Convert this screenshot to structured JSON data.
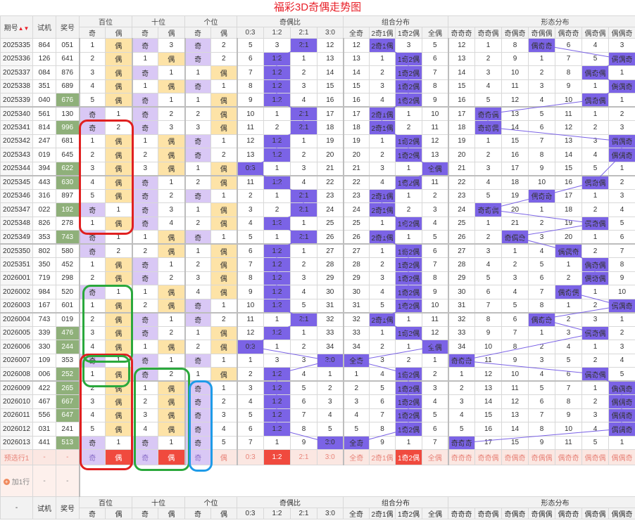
{
  "title": "福彩3D奇偶走势图",
  "header": {
    "issue": "期号",
    "sort_arrow": "▲▼",
    "test": "试机",
    "prize": "奖号",
    "hundreds": "百位",
    "tens": "十位",
    "units": "个位",
    "ratio": "奇偶比",
    "combo": "组合分布",
    "pattern": "形态分布",
    "ji": "奇",
    "ou": "偶",
    "ratio_cols": [
      "0:3",
      "1:2",
      "2:1",
      "3:0"
    ],
    "combo_cols": [
      "全奇",
      "2奇1偶",
      "1奇2偶",
      "全偶"
    ],
    "pattern_cols": [
      "奇奇奇",
      "奇奇偶",
      "奇偶奇",
      "奇偶偶",
      "偶奇奇",
      "偶奇偶",
      "偶偶奇",
      "偶偶偶"
    ]
  },
  "rows": [
    {
      "issue": "2025335",
      "test": "864",
      "prize": "051",
      "c": [
        "1",
        "偶",
        "奇",
        "3",
        "奇",
        "2",
        "5",
        "3",
        "2:1",
        "12",
        "12",
        "2奇1偶",
        "3",
        "5",
        "12",
        "1",
        "8",
        "偶奇奇",
        "6",
        "4",
        "3"
      ]
    },
    {
      "issue": "2025336",
      "test": "126",
      "prize": "641",
      "c": [
        "2",
        "偶",
        "1",
        "偶",
        "奇",
        "2",
        "6",
        "1:2",
        "1",
        "13",
        "13",
        "1",
        "1奇2偶",
        "6",
        "13",
        "2",
        "9",
        "1",
        "7",
        "5",
        "偶偶奇"
      ]
    },
    {
      "issue": "2025337",
      "test": "084",
      "prize": "876",
      "c": [
        "3",
        "偶",
        "奇",
        "1",
        "1",
        "偶",
        "7",
        "1:2",
        "2",
        "14",
        "14",
        "2",
        "1奇2偶",
        "7",
        "14",
        "3",
        "10",
        "2",
        "8",
        "偶奇偶",
        "1"
      ]
    },
    {
      "issue": "2025338",
      "test": "351",
      "prize": "689",
      "c": [
        "4",
        "偶",
        "1",
        "偶",
        "奇",
        "1",
        "8",
        "1:2",
        "3",
        "15",
        "15",
        "3",
        "1奇2偶",
        "8",
        "15",
        "4",
        "11",
        "3",
        "9",
        "1",
        "偶偶奇"
      ]
    },
    {
      "issue": "2025339",
      "test": "040",
      "prize": "676",
      "c": [
        "5",
        "偶",
        "奇",
        "1",
        "1",
        "偶",
        "9",
        "1:2",
        "4",
        "16",
        "16",
        "4",
        "1奇2偶",
        "9",
        "16",
        "5",
        "12",
        "4",
        "10",
        "偶奇偶",
        "1"
      ]
    },
    {
      "issue": "2025340",
      "test": "561",
      "prize": "130",
      "c": [
        "奇",
        "1",
        "奇",
        "2",
        "2",
        "偶",
        "10",
        "1",
        "2:1",
        "17",
        "17",
        "2奇1偶",
        "1",
        "10",
        "17",
        "奇奇偶",
        "13",
        "5",
        "11",
        "1",
        "2"
      ]
    },
    {
      "issue": "2025341",
      "test": "814",
      "prize": "996",
      "c": [
        "奇",
        "2",
        "奇",
        "3",
        "3",
        "偶",
        "11",
        "2",
        "2:1",
        "18",
        "18",
        "2奇1偶",
        "2",
        "11",
        "18",
        "奇奇偶",
        "14",
        "6",
        "12",
        "2",
        "3"
      ]
    },
    {
      "issue": "2025342",
      "test": "247",
      "prize": "681",
      "c": [
        "1",
        "偶",
        "1",
        "偶",
        "奇",
        "1",
        "12",
        "1:2",
        "1",
        "19",
        "19",
        "1",
        "1奇2偶",
        "12",
        "19",
        "1",
        "15",
        "7",
        "13",
        "3",
        "偶偶奇"
      ]
    },
    {
      "issue": "2025343",
      "test": "019",
      "prize": "645",
      "c": [
        "2",
        "偶",
        "2",
        "偶",
        "奇",
        "2",
        "13",
        "1:2",
        "2",
        "20",
        "20",
        "2",
        "1奇2偶",
        "13",
        "20",
        "2",
        "16",
        "8",
        "14",
        "4",
        "偶偶奇"
      ]
    },
    {
      "issue": "2025344",
      "test": "394",
      "prize": "622",
      "c": [
        "3",
        "偶",
        "3",
        "偶",
        "1",
        "偶",
        "0:3",
        "1",
        "3",
        "21",
        "21",
        "3",
        "1",
        "全偶",
        "21",
        "3",
        "17",
        "9",
        "15",
        "5",
        "1"
      ]
    },
    {
      "issue": "2025345",
      "test": "443",
      "prize": "630",
      "c": [
        "4",
        "偶",
        "奇",
        "1",
        "2",
        "偶",
        "11",
        "1:2",
        "4",
        "22",
        "22",
        "4",
        "1奇2偶",
        "11",
        "22",
        "4",
        "18",
        "10",
        "16",
        "偶奇偶",
        "2"
      ]
    },
    {
      "issue": "2025346",
      "test": "316",
      "prize": "897",
      "c": [
        "5",
        "偶",
        "奇",
        "2",
        "奇",
        "1",
        "2",
        "1",
        "2:1",
        "23",
        "23",
        "2奇1偶",
        "1",
        "2",
        "23",
        "5",
        "19",
        "偶奇奇",
        "17",
        "1",
        "3"
      ]
    },
    {
      "issue": "2025347",
      "test": "022",
      "prize": "192",
      "c": [
        "奇",
        "1",
        "奇",
        "3",
        "1",
        "偶",
        "3",
        "2",
        "2:1",
        "24",
        "24",
        "2奇1偶",
        "2",
        "3",
        "24",
        "奇奇偶",
        "20",
        "1",
        "18",
        "2",
        "4"
      ]
    },
    {
      "issue": "2025348",
      "test": "826",
      "prize": "278",
      "c": [
        "1",
        "偶",
        "奇",
        "4",
        "2",
        "偶",
        "4",
        "1:2",
        "1",
        "25",
        "25",
        "1",
        "1奇2偶",
        "4",
        "25",
        "1",
        "21",
        "2",
        "19",
        "偶奇偶",
        "5"
      ]
    },
    {
      "issue": "2025349",
      "test": "353",
      "prize": "743",
      "c": [
        "奇",
        "1",
        "1",
        "偶",
        "奇",
        "1",
        "5",
        "1",
        "2:1",
        "26",
        "26",
        "2奇1偶",
        "1",
        "5",
        "26",
        "2",
        "奇偶奇",
        "3",
        "20",
        "1",
        "6"
      ]
    },
    {
      "issue": "2025350",
      "test": "802",
      "prize": "580",
      "c": [
        "奇",
        "2",
        "2",
        "偶",
        "1",
        "偶",
        "6",
        "1:2",
        "1",
        "27",
        "27",
        "1",
        "1奇2偶",
        "6",
        "27",
        "3",
        "1",
        "4",
        "偶偶奇",
        "2",
        "7"
      ]
    },
    {
      "issue": "2025351",
      "test": "350",
      "prize": "452",
      "c": [
        "1",
        "偶",
        "奇",
        "1",
        "2",
        "偶",
        "7",
        "1:2",
        "2",
        "28",
        "28",
        "2",
        "1奇2偶",
        "7",
        "28",
        "4",
        "2",
        "5",
        "1",
        "偶奇偶",
        "8"
      ]
    },
    {
      "issue": "2026001",
      "test": "719",
      "prize": "298",
      "c": [
        "2",
        "偶",
        "奇",
        "2",
        "3",
        "偶",
        "8",
        "1:2",
        "3",
        "29",
        "29",
        "3",
        "1奇2偶",
        "8",
        "29",
        "5",
        "3",
        "6",
        "2",
        "偶奇偶",
        "9"
      ]
    },
    {
      "issue": "2026002",
      "test": "984",
      "prize": "520",
      "c": [
        "奇",
        "1",
        "1",
        "偶",
        "4",
        "偶",
        "9",
        "1:2",
        "4",
        "30",
        "30",
        "4",
        "1奇2偶",
        "9",
        "30",
        "6",
        "4",
        "7",
        "偶奇偶",
        "1",
        "10"
      ]
    },
    {
      "issue": "2026003",
      "test": "167",
      "prize": "601",
      "c": [
        "1",
        "偶",
        "2",
        "偶",
        "奇",
        "1",
        "10",
        "1:2",
        "5",
        "31",
        "31",
        "5",
        "1奇2偶",
        "10",
        "31",
        "7",
        "5",
        "8",
        "1",
        "2",
        "偶偶奇"
      ]
    },
    {
      "issue": "2026004",
      "test": "743",
      "prize": "019",
      "c": [
        "2",
        "偶",
        "奇",
        "1",
        "奇",
        "2",
        "11",
        "1",
        "2:1",
        "32",
        "32",
        "2奇1偶",
        "1",
        "11",
        "32",
        "8",
        "6",
        "偶奇奇",
        "2",
        "3",
        "1"
      ]
    },
    {
      "issue": "2026005",
      "test": "339",
      "prize": "476",
      "c": [
        "3",
        "偶",
        "奇",
        "2",
        "1",
        "偶",
        "12",
        "1:2",
        "1",
        "33",
        "33",
        "1",
        "1奇2偶",
        "12",
        "33",
        "9",
        "7",
        "1",
        "3",
        "偶奇偶",
        "2"
      ]
    },
    {
      "issue": "2026006",
      "test": "330",
      "prize": "244",
      "c": [
        "4",
        "偶",
        "1",
        "偶",
        "2",
        "偶",
        "0:3",
        "1",
        "2",
        "34",
        "34",
        "2",
        "1",
        "全偶",
        "34",
        "10",
        "8",
        "2",
        "4",
        "1",
        "3"
      ]
    },
    {
      "issue": "2026007",
      "test": "109",
      "prize": "353",
      "c": [
        "奇",
        "1",
        "奇",
        "1",
        "奇",
        "1",
        "1",
        "3",
        "3",
        "3:0",
        "全奇",
        "3",
        "2",
        "1",
        "奇奇奇",
        "11",
        "9",
        "3",
        "5",
        "2",
        "4"
      ]
    },
    {
      "issue": "2026008",
      "test": "006",
      "prize": "252",
      "c": [
        "1",
        "偶",
        "奇",
        "2",
        "1",
        "偶",
        "2",
        "1:2",
        "4",
        "1",
        "1",
        "4",
        "1奇2偶",
        "2",
        "1",
        "12",
        "10",
        "4",
        "6",
        "偶奇偶",
        "5"
      ]
    },
    {
      "issue": "2026009",
      "test": "422",
      "prize": "265",
      "c": [
        "2",
        "偶",
        "1",
        "偶",
        "奇",
        "1",
        "3",
        "1:2",
        "5",
        "2",
        "2",
        "5",
        "1奇2偶",
        "3",
        "2",
        "13",
        "11",
        "5",
        "7",
        "1",
        "偶偶奇"
      ]
    },
    {
      "issue": "2026010",
      "test": "467",
      "prize": "667",
      "c": [
        "3",
        "偶",
        "2",
        "偶",
        "奇",
        "2",
        "4",
        "1:2",
        "6",
        "3",
        "3",
        "6",
        "1奇2偶",
        "4",
        "3",
        "14",
        "12",
        "6",
        "8",
        "2",
        "偶偶奇"
      ]
    },
    {
      "issue": "2026011",
      "test": "556",
      "prize": "647",
      "c": [
        "4",
        "偶",
        "3",
        "偶",
        "奇",
        "3",
        "5",
        "1:2",
        "7",
        "4",
        "4",
        "7",
        "1奇2偶",
        "5",
        "4",
        "15",
        "13",
        "7",
        "9",
        "3",
        "偶偶奇"
      ]
    },
    {
      "issue": "2026012",
      "test": "031",
      "prize": "241",
      "c": [
        "5",
        "偶",
        "4",
        "偶",
        "奇",
        "4",
        "6",
        "1:2",
        "8",
        "5",
        "5",
        "8",
        "1奇2偶",
        "6",
        "5",
        "16",
        "14",
        "8",
        "10",
        "4",
        "偶偶奇"
      ]
    },
    {
      "issue": "2026013",
      "test": "441",
      "prize": "513",
      "c": [
        "奇",
        "1",
        "奇",
        "1",
        "奇",
        "5",
        "7",
        "1",
        "9",
        "3:0",
        "全奇",
        "9",
        "1",
        "7",
        "奇奇奇",
        "17",
        "15",
        "9",
        "11",
        "5",
        "1"
      ]
    }
  ],
  "predict": {
    "label": "预选行1",
    "dash": "-",
    "c": [
      "奇",
      "偶",
      "奇",
      "偶",
      "奇",
      "偶",
      "0:3",
      "1:2",
      "2:1",
      "3:0",
      "全奇",
      "2奇1偶",
      "1奇2偶",
      "全偶",
      "奇奇奇",
      "奇奇偶",
      "奇偶奇",
      "奇偶偶",
      "偶奇奇",
      "偶奇偶",
      "偶偶奇",
      "偶偶偶"
    ],
    "red": [
      1,
      3,
      7,
      12,
      21
    ],
    "ji": [
      0,
      2,
      4
    ]
  },
  "add_row": {
    "icon": "+",
    "label": "加1行",
    "dash": "-"
  },
  "footer": {
    "dash": "-"
  },
  "highlight_rows": [
    "2025340",
    "2025345",
    "2025350",
    "2026004",
    "2026009",
    "2026013"
  ],
  "green_prize_rows": [
    "2025339",
    "2025341",
    "2025344",
    "2025345",
    "2025347",
    "2025349",
    "2026005",
    "2026006",
    "2026008",
    "2026009",
    "2026010",
    "2026011",
    "2026013"
  ],
  "colors": {
    "title": "#e8212a",
    "ji": "#d9c8f5",
    "ou": "#fde3a7",
    "hit": "#7b63e6",
    "green": "#8fb07a",
    "red": "#f04a3e",
    "ann_red": "#e02020",
    "ann_green": "#2aa83c",
    "ann_blue": "#1e9be8"
  }
}
